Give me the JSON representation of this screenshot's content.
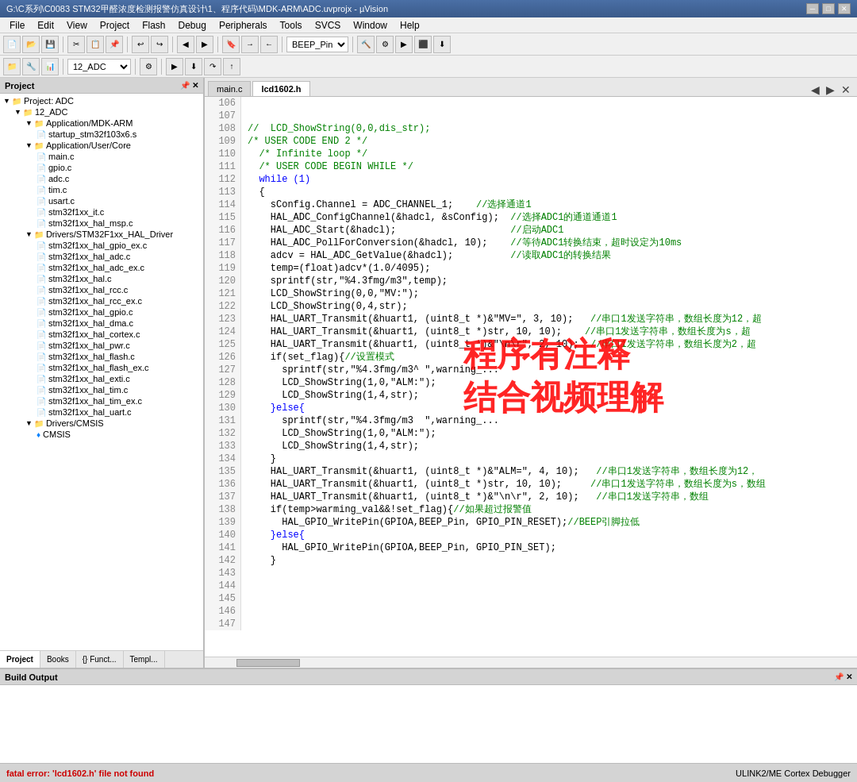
{
  "titleBar": {
    "text": "G:\\C系列\\C0083 STM32甲醛浓度检测报警仿真设计\\1、程序代码\\MDK-ARM\\ADC.uvprojx - µVision",
    "minBtn": "─",
    "maxBtn": "□",
    "closeBtn": "✕"
  },
  "menuBar": {
    "items": [
      "File",
      "Edit",
      "View",
      "Project",
      "Flash",
      "Debug",
      "Peripherals",
      "Tools",
      "SVCS",
      "Window",
      "Help"
    ]
  },
  "toolbar1": {
    "targetSelect": "BEEP_Pin"
  },
  "toolbar2": {
    "projectSelect": "12_ADC"
  },
  "projectPanel": {
    "title": "Project",
    "root": "Project: ADC",
    "tree": [
      {
        "level": 0,
        "type": "folder",
        "label": "Project: ADC",
        "expanded": true
      },
      {
        "level": 1,
        "type": "folder",
        "label": "12_ADC",
        "expanded": true
      },
      {
        "level": 2,
        "type": "folder",
        "label": "Application/MDK-ARM",
        "expanded": true
      },
      {
        "level": 3,
        "type": "file",
        "label": "startup_stm32f103x6.s"
      },
      {
        "level": 2,
        "type": "folder",
        "label": "Application/User/Core",
        "expanded": true
      },
      {
        "level": 3,
        "type": "file",
        "label": "main.c"
      },
      {
        "level": 3,
        "type": "file",
        "label": "gpio.c"
      },
      {
        "level": 3,
        "type": "file",
        "label": "adc.c"
      },
      {
        "level": 3,
        "type": "file",
        "label": "tim.c"
      },
      {
        "level": 3,
        "type": "file",
        "label": "usart.c"
      },
      {
        "level": 3,
        "type": "file",
        "label": "stm32f1xx_it.c"
      },
      {
        "level": 3,
        "type": "file",
        "label": "stm32f1xx_hal_msp.c"
      },
      {
        "level": 2,
        "type": "folder",
        "label": "Drivers/STM32F1xx_HAL_Driver",
        "expanded": true
      },
      {
        "level": 3,
        "type": "file",
        "label": "stm32f1xx_hal_gpio_ex.c"
      },
      {
        "level": 3,
        "type": "file",
        "label": "stm32f1xx_hal_adc.c"
      },
      {
        "level": 3,
        "type": "file",
        "label": "stm32f1xx_hal_adc_ex.c"
      },
      {
        "level": 3,
        "type": "file",
        "label": "stm32f1xx_hal.c"
      },
      {
        "level": 3,
        "type": "file",
        "label": "stm32f1xx_hal_rcc.c"
      },
      {
        "level": 3,
        "type": "file",
        "label": "stm32f1xx_hal_rcc_ex.c"
      },
      {
        "level": 3,
        "type": "file",
        "label": "stm32f1xx_hal_gpio.c"
      },
      {
        "level": 3,
        "type": "file",
        "label": "stm32f1xx_hal_dma.c"
      },
      {
        "level": 3,
        "type": "file",
        "label": "stm32f1xx_hal_cortex.c"
      },
      {
        "level": 3,
        "type": "file",
        "label": "stm32f1xx_hal_pwr.c"
      },
      {
        "level": 3,
        "type": "file",
        "label": "stm32f1xx_hal_flash.c"
      },
      {
        "level": 3,
        "type": "file",
        "label": "stm32f1xx_hal_flash_ex.c"
      },
      {
        "level": 3,
        "type": "file",
        "label": "stm32f1xx_hal_exti.c"
      },
      {
        "level": 3,
        "type": "file",
        "label": "stm32f1xx_hal_tim.c"
      },
      {
        "level": 3,
        "type": "file",
        "label": "stm32f1xx_hal_tim_ex.c"
      },
      {
        "level": 3,
        "type": "file",
        "label": "stm32f1xx_hal_uart.c"
      },
      {
        "level": 2,
        "type": "folder",
        "label": "Drivers/CMSIS",
        "expanded": true
      },
      {
        "level": 3,
        "type": "file",
        "label": "CMSIS",
        "icon": "diamond"
      }
    ],
    "tabs": [
      {
        "label": "Project",
        "active": true
      },
      {
        "label": "Books",
        "active": false
      },
      {
        "label": "{} Funct...",
        "active": false
      },
      {
        "label": "Templ...",
        "active": false
      }
    ]
  },
  "editorTabs": [
    {
      "label": "main.c",
      "active": false
    },
    {
      "label": "lcd1602.h",
      "active": true
    }
  ],
  "codeLines": [
    {
      "num": 106,
      "text": "//  LCD_ShowString(0,0,dis_str);",
      "type": "comment"
    },
    {
      "num": 107,
      "text": "/* USER CODE END 2 */",
      "type": "comment"
    },
    {
      "num": 108,
      "text": "",
      "type": "normal"
    },
    {
      "num": 109,
      "text": "  /* Infinite loop */",
      "type": "comment"
    },
    {
      "num": 110,
      "text": "  /* USER CODE BEGIN WHILE */",
      "type": "comment"
    },
    {
      "num": 111,
      "text": "  while (1)",
      "type": "keyword"
    },
    {
      "num": 112,
      "text": "  {",
      "type": "normal"
    },
    {
      "num": 113,
      "text": "    sConfig.Channel = ADC_CHANNEL_1;    //选择通道1",
      "type": "mixed"
    },
    {
      "num": 114,
      "text": "    HAL_ADC_ConfigChannel(&hadcl, &sConfig);  //选择ADC1的通道通道1",
      "type": "mixed"
    },
    {
      "num": 115,
      "text": "    HAL_ADC_Start(&hadcl);                    //启动ADC1",
      "type": "mixed"
    },
    {
      "num": 116,
      "text": "    HAL_ADC_PollForConversion(&hadcl, 10);    //等待ADC1转换结束，超时设定为10ms",
      "type": "mixed"
    },
    {
      "num": 117,
      "text": "    adcv = HAL_ADC_GetValue(&hadcl);          //读取ADC1的转换结果",
      "type": "mixed"
    },
    {
      "num": 118,
      "text": "",
      "type": "normal"
    },
    {
      "num": 119,
      "text": "",
      "type": "normal"
    },
    {
      "num": 120,
      "text": "    temp=(float)adcv*(1.0/4095);",
      "type": "normal"
    },
    {
      "num": 121,
      "text": "",
      "type": "normal"
    },
    {
      "num": 122,
      "text": "    sprintf(str,\"%4.3fmg/m3\",temp);",
      "type": "normal"
    },
    {
      "num": 123,
      "text": "    LCD_ShowString(0,0,\"MV:\");",
      "type": "normal"
    },
    {
      "num": 124,
      "text": "    LCD_ShowString(0,4,str);",
      "type": "normal"
    },
    {
      "num": 125,
      "text": "    HAL_UART_Transmit(&huart1, (uint8_t *)&\"MV=\", 3, 10);   //串口1发送字符串，数组长度为12，超",
      "type": "mixed"
    },
    {
      "num": 126,
      "text": "    HAL_UART_Transmit(&huart1, (uint8_t *)str, 10, 10);    //串口1发送字符串，数组长度为s，超",
      "type": "mixed"
    },
    {
      "num": 127,
      "text": "    HAL_UART_Transmit(&huart1, (uint8_t *)&\"\\n\\r\", 2, 10);  //串口1发送字符串，数组长度为2，超",
      "type": "mixed"
    },
    {
      "num": 128,
      "text": "",
      "type": "normal"
    },
    {
      "num": 129,
      "text": "    if(set_flag){//设置模式",
      "type": "mixed"
    },
    {
      "num": 130,
      "text": "      sprintf(str,\"%4.3fmg/m3^ \",warning_...",
      "type": "normal"
    },
    {
      "num": 131,
      "text": "      LCD_ShowString(1,0,\"ALM:\");",
      "type": "normal"
    },
    {
      "num": 132,
      "text": "      LCD_ShowString(1,4,str);",
      "type": "normal"
    },
    {
      "num": 133,
      "text": "    }else{",
      "type": "keyword"
    },
    {
      "num": 134,
      "text": "      sprintf(str,\"%4.3fmg/m3  \",warning_...",
      "type": "normal"
    },
    {
      "num": 135,
      "text": "      LCD_ShowString(1,0,\"ALM:\");",
      "type": "normal"
    },
    {
      "num": 136,
      "text": "      LCD_ShowString(1,4,str);",
      "type": "normal"
    },
    {
      "num": 137,
      "text": "    }",
      "type": "normal"
    },
    {
      "num": 138,
      "text": "",
      "type": "normal"
    },
    {
      "num": 139,
      "text": "    HAL_UART_Transmit(&huart1, (uint8_t *)&\"ALM=\", 4, 10);   //串口1发送字符串，数组长度为12，",
      "type": "mixed"
    },
    {
      "num": 140,
      "text": "    HAL_UART_Transmit(&huart1, (uint8_t *)str, 10, 10);     //串口1发送字符串，数组长度为s，数组",
      "type": "mixed"
    },
    {
      "num": 141,
      "text": "    HAL_UART_Transmit(&huart1, (uint8_t *)&\"\\n\\r\", 2, 10);   //串口1发送字符串，数组",
      "type": "mixed"
    },
    {
      "num": 142,
      "text": "",
      "type": "normal"
    },
    {
      "num": 143,
      "text": "    if(temp>warming_val&&!set_flag){//如果超过报警值",
      "type": "mixed"
    },
    {
      "num": 144,
      "text": "      HAL_GPIO_WritePin(GPIOA,BEEP_Pin, GPIO_PIN_RESET);//BEEP引脚拉低",
      "type": "mixed"
    },
    {
      "num": 145,
      "text": "    }else{",
      "type": "keyword"
    },
    {
      "num": 146,
      "text": "      HAL_GPIO_WritePin(GPIOA,BEEP_Pin, GPIO_PIN_SET);",
      "type": "normal"
    },
    {
      "num": 147,
      "text": "    }",
      "type": "normal"
    }
  ],
  "watermark": {
    "line1": "程序有注释",
    "line2": "结合视频理解"
  },
  "buildOutput": {
    "title": "Build Output",
    "content": ""
  },
  "statusBar": {
    "leftText": "fatal error: 'lcd1602.h' file not found",
    "rightText": "ULINK2/ME Cortex Debugger"
  }
}
